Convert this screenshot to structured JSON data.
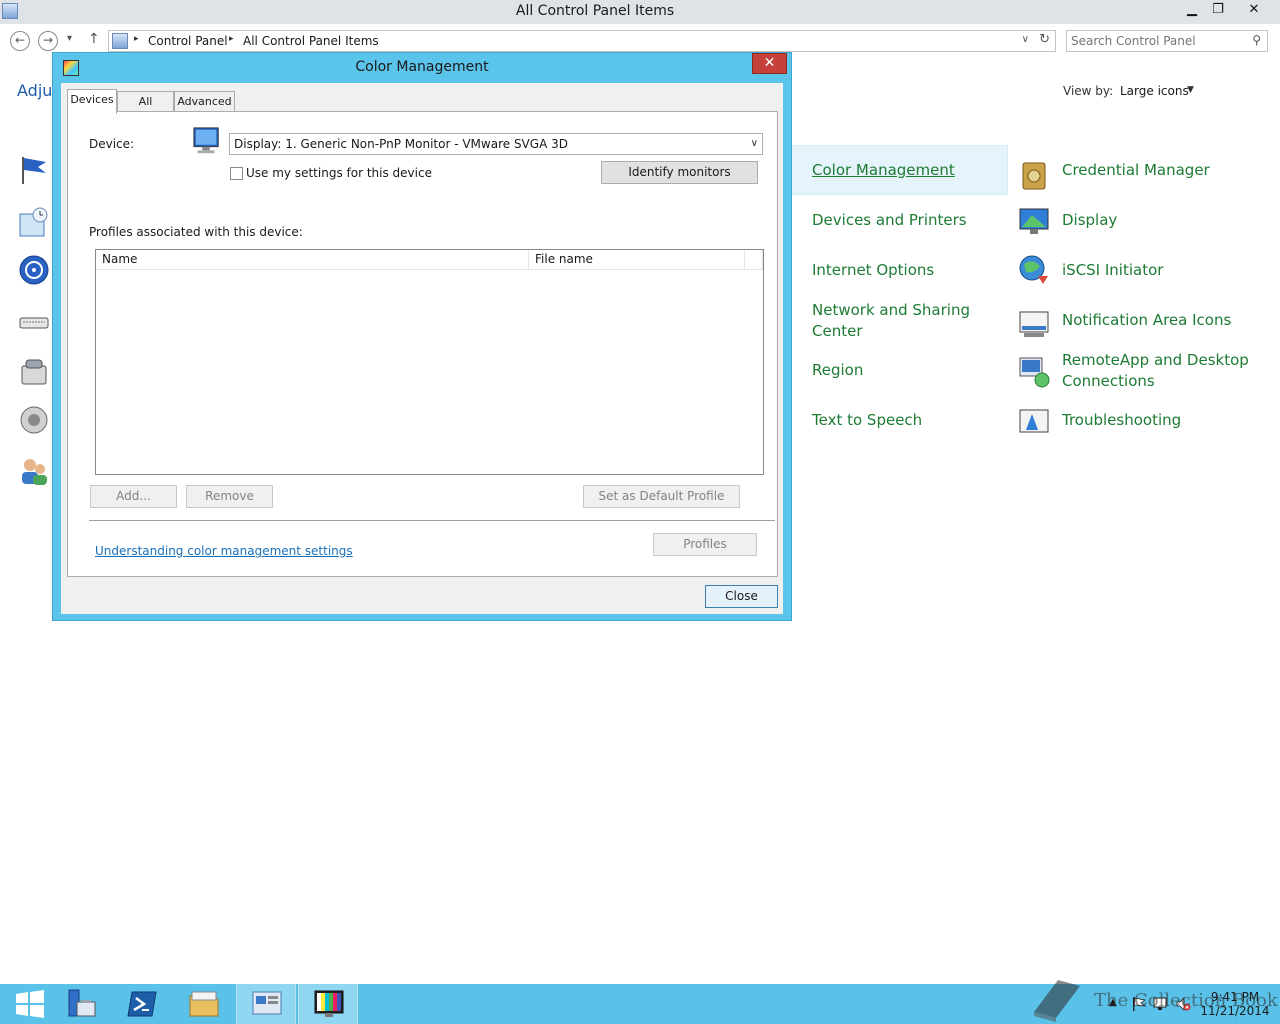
{
  "window": {
    "title": "All Control Panel Items",
    "minimize": "▁",
    "restore": "❐",
    "close": "✕"
  },
  "address": {
    "back": "←",
    "forward": "→",
    "history": "▾",
    "up": "↑",
    "separator": "▸",
    "breadcrumbs": [
      "Control Panel",
      "All Control Panel Items"
    ],
    "dropdown": "∨",
    "refresh": "↻"
  },
  "search": {
    "placeholder": "Search Control Panel",
    "icon": "⚲"
  },
  "content": {
    "heading_partial": "Adjus",
    "view_by_label": "View by:",
    "view_by_value": "Large icons",
    "view_by_arrow": "▼"
  },
  "cp_items": {
    "color_management": "Color Management",
    "credential_manager": "Credential Manager",
    "devices_printers": "Devices and Printers",
    "display": "Display",
    "internet_options": "Internet Options",
    "iscsi_initiator": "iSCSI Initiator",
    "network_sharing_1": "Network and Sharing",
    "network_sharing_2": "Center",
    "notification_area": "Notification Area Icons",
    "region": "Region",
    "remoteapp_1": "RemoteApp and Desktop",
    "remoteapp_2": "Connections",
    "text_to_speech": "Text to Speech",
    "troubleshooting": "Troubleshooting"
  },
  "dialog": {
    "title": "Color Management",
    "close_x": "✕",
    "tabs": [
      "Devices",
      "All Profiles",
      "Advanced"
    ],
    "device_label": "Device:",
    "device_value": "Display: 1. Generic Non-PnP Monitor - VMware SVGA 3D",
    "device_arrow": "∨",
    "use_settings_label": "Use my settings for this device",
    "identify_button": "Identify monitors",
    "profiles_label": "Profiles associated with this device:",
    "columns": [
      "Name",
      "File name"
    ],
    "add_button": "Add...",
    "remove_button": "Remove",
    "set_default_button": "Set as Default Profile",
    "link": "Understanding color management settings",
    "profiles_button": "Profiles",
    "close_button": "Close"
  },
  "taskbar": {
    "clock_time": "9:41 PM",
    "clock_date": "11/21/2014",
    "tray_arrow": "▲",
    "watermark": "The Collection Book"
  },
  "colors": {
    "dialog_frame": "#5bc4ea",
    "taskbar": "#5ac2e8",
    "cp_link": "#1d7b34",
    "close_red": "#c7413b"
  }
}
